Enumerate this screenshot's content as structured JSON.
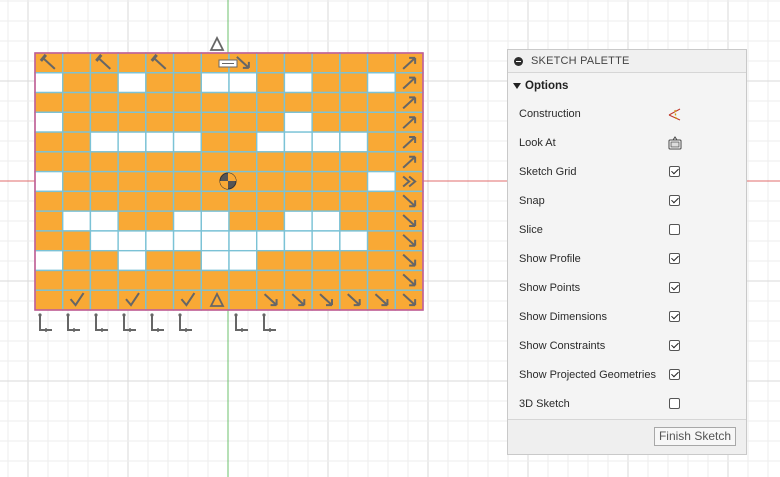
{
  "palette": {
    "title": "SKETCH PALETTE",
    "section": "Options",
    "options": [
      {
        "label": "Construction",
        "control": "icon",
        "icon": "construction-icon"
      },
      {
        "label": "Look At",
        "control": "icon",
        "icon": "look-at-icon"
      },
      {
        "label": "Sketch Grid",
        "control": "checkbox",
        "checked": true
      },
      {
        "label": "Snap",
        "control": "checkbox",
        "checked": true
      },
      {
        "label": "Slice",
        "control": "checkbox",
        "checked": false
      },
      {
        "label": "Show Profile",
        "control": "checkbox",
        "checked": true
      },
      {
        "label": "Show Points",
        "control": "checkbox",
        "checked": true
      },
      {
        "label": "Show Dimensions",
        "control": "checkbox",
        "checked": true
      },
      {
        "label": "Show Constraints",
        "control": "checkbox",
        "checked": true
      },
      {
        "label": "Show Projected Geometries",
        "control": "checkbox",
        "checked": true
      },
      {
        "label": "3D Sketch",
        "control": "checkbox",
        "checked": false
      }
    ],
    "finish_label": "Finish Sketch"
  },
  "sketch": {
    "rows": 13,
    "cols": 14,
    "pattern": [
      "11111111111111",
      "01101100101101",
      "11111111111111",
      "01111111101111",
      "11000011000011",
      "11111111111111",
      "01111111111101",
      "11111111111111",
      "10011001100111",
      "11000000000011",
      "01101100111111",
      "11111111111111",
      "11111111111111"
    ],
    "colors": {
      "profile_fill": "#f9a935",
      "open_cell": "#ffffff",
      "grid_line": "#7bc2d6",
      "outline": "#c9578f",
      "x_axis": "#e06c6c",
      "y_axis": "#6cc06c",
      "grid_minor": "#eeeeee",
      "grid_major": "#dadada",
      "constraint_glyph": "#666666"
    }
  }
}
